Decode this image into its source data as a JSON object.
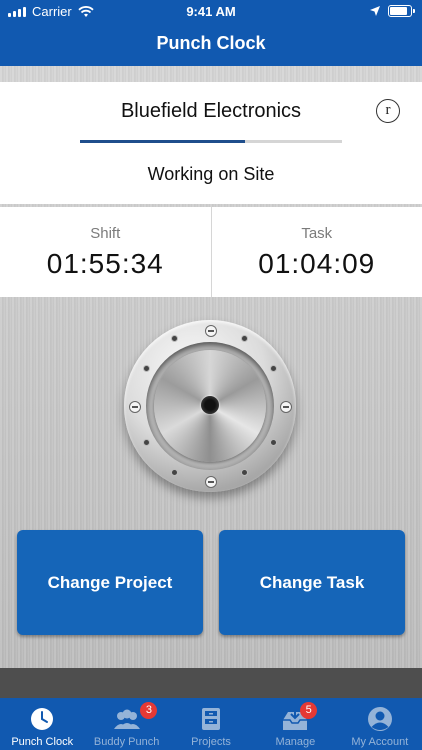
{
  "status_bar": {
    "carrier": "Carrier",
    "time": "9:41 AM"
  },
  "nav": {
    "title": "Punch Clock"
  },
  "company": {
    "name": "Bluefield Electronics",
    "info_icon_letter": "r",
    "status": "Working on Site",
    "progress_fraction": 0.63
  },
  "timers": {
    "shift": {
      "label": "Shift",
      "value": "01:55:34"
    },
    "task": {
      "label": "Task",
      "value": "01:04:09"
    }
  },
  "actions": {
    "change_project": "Change Project",
    "change_task": "Change Task"
  },
  "tabs": [
    {
      "label": "Punch Clock",
      "icon": "clock-icon",
      "active": true,
      "badge": ""
    },
    {
      "label": "Buddy Punch",
      "icon": "group-icon",
      "active": false,
      "badge": "3"
    },
    {
      "label": "Projects",
      "icon": "cabinet-icon",
      "active": false,
      "badge": ""
    },
    {
      "label": "Manage",
      "icon": "inbox-download-icon",
      "active": false,
      "badge": "5"
    },
    {
      "label": "My Account",
      "icon": "user-icon",
      "active": false,
      "badge": ""
    }
  ],
  "colors": {
    "brand_blue": "#1159b0",
    "button_blue": "#1565b8",
    "badge_red": "#e53935"
  }
}
